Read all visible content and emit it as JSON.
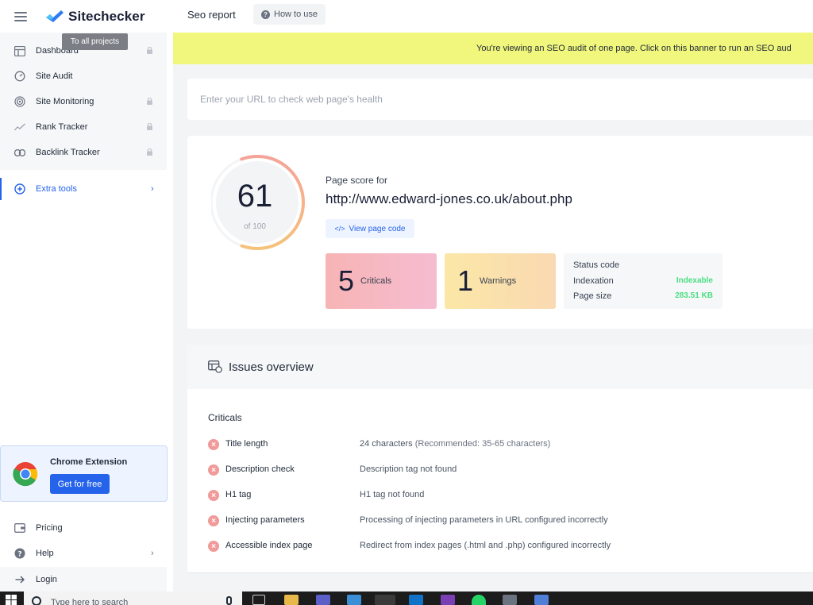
{
  "app": {
    "brand": "Sitechecker",
    "header_title": "Seo report",
    "how_to_label": "How to use",
    "tooltip": "To all projects"
  },
  "sidebar": {
    "items": [
      {
        "label": "Dashboard",
        "icon": "dashboard-icon",
        "locked": true
      },
      {
        "label": "Site Audit",
        "icon": "gauge-icon",
        "locked": false
      },
      {
        "label": "Site Monitoring",
        "icon": "radar-icon",
        "locked": true
      },
      {
        "label": "Rank Tracker",
        "icon": "trend-line-icon",
        "locked": true
      },
      {
        "label": "Backlink Tracker",
        "icon": "link-icon",
        "locked": true
      }
    ],
    "extra_tools": "Extra tools",
    "chrome_extension": {
      "title": "Chrome Extension",
      "button": "Get for free"
    },
    "bottom": {
      "pricing": "Pricing",
      "help": "Help",
      "login": "Login"
    }
  },
  "banner": {
    "text": "You're viewing an SEO audit of one page. Click on this banner to run an SEO aud"
  },
  "url_input": {
    "placeholder": "Enter your URL to check web page's health",
    "value": ""
  },
  "score": {
    "value": "61",
    "of_label": "of 100",
    "fraction": 0.61,
    "page_score_label": "Page score for",
    "url": "http://www.edward-jones.co.uk/about.php",
    "view_code_label": "View page code",
    "criticals": {
      "count": "5",
      "label": "Criticals"
    },
    "warnings": {
      "count": "1",
      "label": "Warnings"
    },
    "status": {
      "status_code_label": "Status code",
      "status_code_value": "",
      "indexation_label": "Indexation",
      "indexation_value": "Indexable",
      "page_size_label": "Page size",
      "page_size_value": "283.51 KB"
    }
  },
  "issues": {
    "title": "Issues overview",
    "criticals_heading": "Criticals",
    "rows": [
      {
        "name": "Title length",
        "desc": "24 characters",
        "rec": "(Recommended: 35-65 characters)"
      },
      {
        "name": "Description check",
        "desc": "Description tag not found",
        "rec": ""
      },
      {
        "name": "H1 tag",
        "desc": "H1 tag not found",
        "rec": ""
      },
      {
        "name": "Injecting parameters",
        "desc": "Processing of injecting parameters in URL configured incorrectly",
        "rec": ""
      },
      {
        "name": "Accessible index page",
        "desc": "Redirect from index pages (.html and .php) configured incorrectly",
        "rec": ""
      }
    ]
  },
  "taskbar": {
    "search_placeholder": "Type here to search"
  },
  "colors": {
    "accent": "#2563eb",
    "banner": "#f1f77c",
    "success": "#4ade80",
    "critical": "#f19a9a"
  }
}
